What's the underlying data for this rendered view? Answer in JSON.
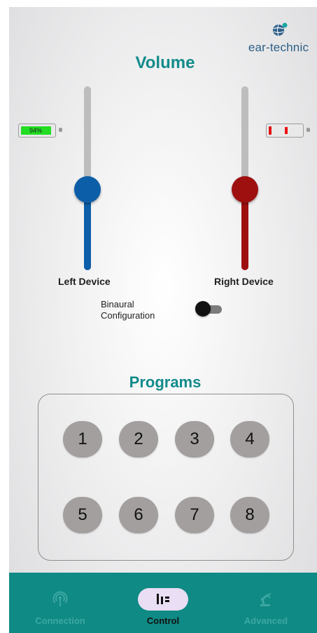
{
  "logo": {
    "text": "ear-technic"
  },
  "volume": {
    "title": "Volume",
    "left": {
      "label": "Left Device",
      "level": 0.44,
      "color": "#0d5ea8",
      "battery_text": "94%",
      "battery_level": 0.94,
      "battery_color": "#22dd22"
    },
    "right": {
      "label": "Right Device",
      "level": 0.44,
      "color": "#9e1010",
      "battery_level": 0.08,
      "battery_color": "#e11111"
    }
  },
  "binaural": {
    "label_line1": "Binaural",
    "label_line2": "Configuration",
    "enabled": false
  },
  "programs": {
    "title": "Programs",
    "buttons": [
      "1",
      "2",
      "3",
      "4",
      "5",
      "6",
      "7",
      "8"
    ]
  },
  "nav": {
    "items": [
      {
        "label": "Connection",
        "icon": "antenna-icon",
        "active": false
      },
      {
        "label": "Control",
        "icon": "equalizer-icon",
        "active": true
      },
      {
        "label": "Advanced",
        "icon": "robot-arm-icon",
        "active": false
      }
    ]
  },
  "colors": {
    "accent": "#148b8b",
    "nav_bg": "#0f8a85",
    "program_button": "#a39f9e"
  }
}
